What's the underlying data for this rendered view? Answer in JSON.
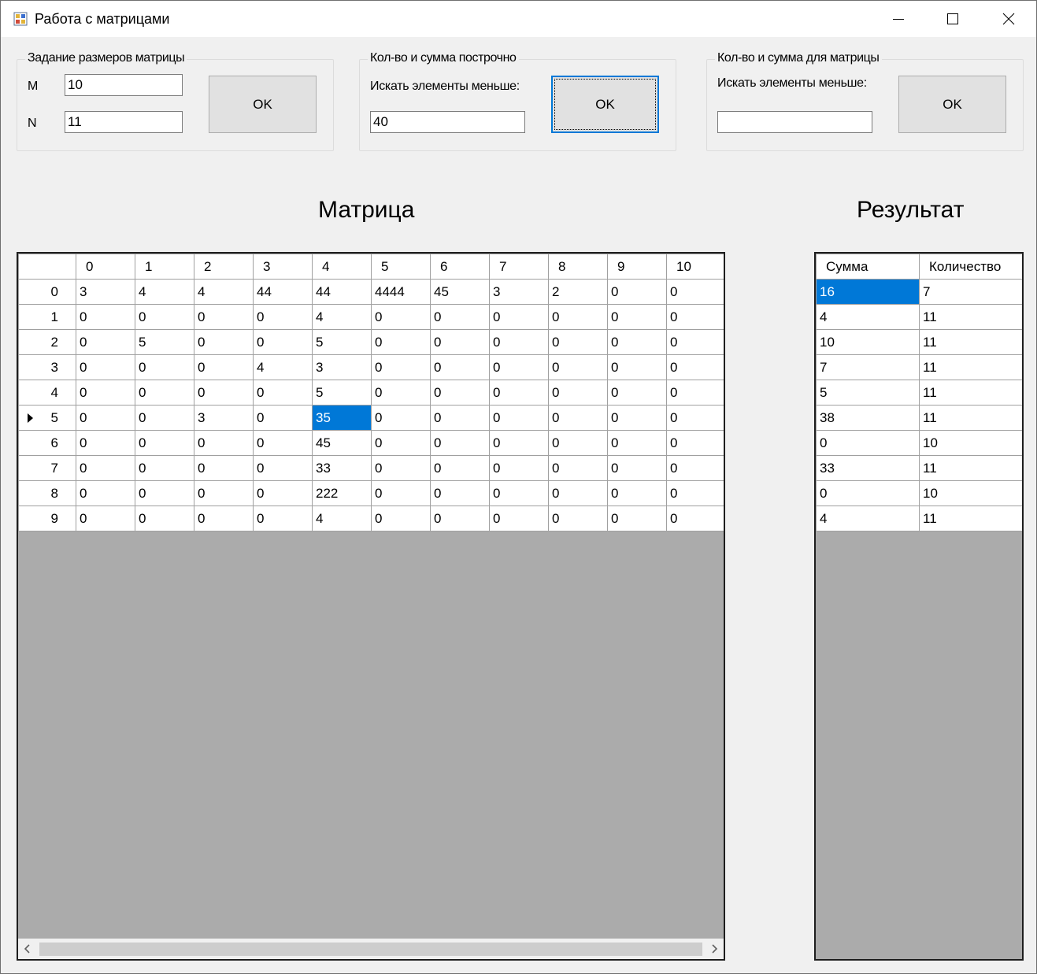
{
  "window": {
    "title": "Работа с матрицами"
  },
  "size_group": {
    "title": "Задание размеров матрицы",
    "m_label": "M",
    "m_value": "10",
    "n_label": "N",
    "n_value": "11",
    "ok_label": "OK"
  },
  "row_group": {
    "title": "Кол-во и сумма построчно",
    "prompt": "Искать элементы меньше:",
    "value": "40",
    "ok_label": "OK"
  },
  "matrix_group": {
    "title": "Кол-во и сумма для матрицы",
    "prompt": "Искать элементы меньше:",
    "value": "",
    "ok_label": "OK"
  },
  "matrix_heading": "Матрица",
  "result_heading": "Результат",
  "matrix": {
    "columns": [
      "0",
      "1",
      "2",
      "3",
      "4",
      "5",
      "6",
      "7",
      "8",
      "9",
      "10"
    ],
    "row_headers": [
      "0",
      "1",
      "2",
      "3",
      "4",
      "5",
      "6",
      "7",
      "8",
      "9"
    ],
    "current_row": 5,
    "selected_cell": [
      5,
      4
    ],
    "rows": [
      [
        "3",
        "4",
        "4",
        "44",
        "44",
        "4444",
        "45",
        "3",
        "2",
        "0",
        "0"
      ],
      [
        "0",
        "0",
        "0",
        "0",
        "4",
        "0",
        "0",
        "0",
        "0",
        "0",
        "0"
      ],
      [
        "0",
        "5",
        "0",
        "0",
        "5",
        "0",
        "0",
        "0",
        "0",
        "0",
        "0"
      ],
      [
        "0",
        "0",
        "0",
        "4",
        "3",
        "0",
        "0",
        "0",
        "0",
        "0",
        "0"
      ],
      [
        "0",
        "0",
        "0",
        "0",
        "5",
        "0",
        "0",
        "0",
        "0",
        "0",
        "0"
      ],
      [
        "0",
        "0",
        "3",
        "0",
        "35",
        "0",
        "0",
        "0",
        "0",
        "0",
        "0"
      ],
      [
        "0",
        "0",
        "0",
        "0",
        "45",
        "0",
        "0",
        "0",
        "0",
        "0",
        "0"
      ],
      [
        "0",
        "0",
        "0",
        "0",
        "33",
        "0",
        "0",
        "0",
        "0",
        "0",
        "0"
      ],
      [
        "0",
        "0",
        "0",
        "0",
        "222",
        "0",
        "0",
        "0",
        "0",
        "0",
        "0"
      ],
      [
        "0",
        "0",
        "0",
        "0",
        "4",
        "0",
        "0",
        "0",
        "0",
        "0",
        "0"
      ]
    ]
  },
  "result": {
    "columns": [
      "Сумма",
      "Количество"
    ],
    "selected_cell": [
      0,
      0
    ],
    "rows": [
      [
        "16",
        "7"
      ],
      [
        "4",
        "11"
      ],
      [
        "10",
        "11"
      ],
      [
        "7",
        "11"
      ],
      [
        "5",
        "11"
      ],
      [
        "38",
        "11"
      ],
      [
        "0",
        "10"
      ],
      [
        "33",
        "11"
      ],
      [
        "0",
        "10"
      ],
      [
        "4",
        "11"
      ]
    ]
  }
}
